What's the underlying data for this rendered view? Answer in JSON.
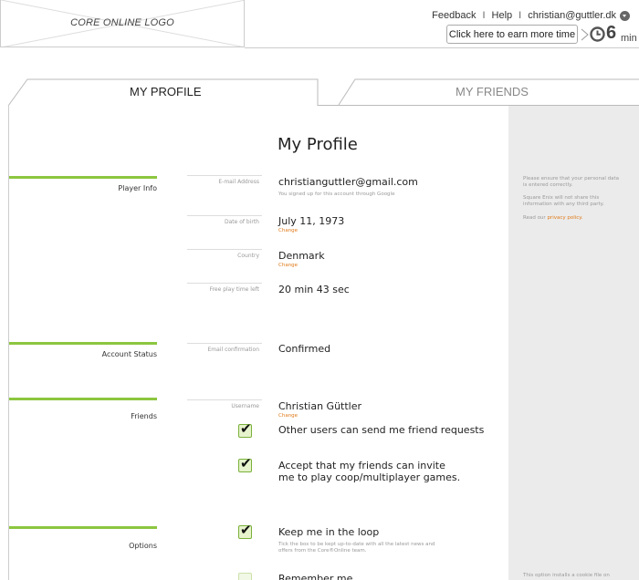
{
  "header": {
    "logo_text": "CORE ONLINE LOGO",
    "links": {
      "feedback": "Feedback",
      "help": "Help",
      "user": "christian@guttler.dk",
      "separator": "I"
    },
    "earn_button": "Click here to earn more time",
    "time_value": "6",
    "time_unit": "min"
  },
  "tabs": [
    {
      "label": "MY PROFILE",
      "active": true
    },
    {
      "label": "MY FRIENDS",
      "active": false
    }
  ],
  "page_title": "My Profile",
  "sections": {
    "player_info": "Player Info",
    "account_status": "Account Status",
    "friends": "Friends",
    "options": "Options"
  },
  "fields": {
    "email": {
      "label": "E-mail Address",
      "value": "christianguttler@gmail.com",
      "note": "You signed up for this account through Google"
    },
    "dob": {
      "label": "Date of birth",
      "value": "July 11, 1973",
      "change": "Change"
    },
    "country": {
      "label": "Country",
      "value": "Denmark",
      "change": "Change"
    },
    "playtime": {
      "label": "Free play time left",
      "value": "20 min 43 sec"
    },
    "email_confirmation": {
      "label": "Email confirmation",
      "value": "Confirmed"
    },
    "username": {
      "label": "Username",
      "value": "Christian Güttler",
      "change": "Change"
    }
  },
  "checkboxes": {
    "friend_requests": {
      "label": "Other users can send me friend requests",
      "checked": true
    },
    "coop_invites": {
      "label": "Accept that my friends can invite me to play coop/multiplayer games.",
      "checked": true
    },
    "loop": {
      "label": "Keep me in the loop",
      "checked": true,
      "note": "Tick the box to be kept up-to-date with all the latest news and offers from the Core®Online team."
    },
    "remember": {
      "label": "Remember me",
      "checked": false
    }
  },
  "sidebar": {
    "note1": "Please ensure that your personal data is entered correctly.",
    "note2": "Square Enix will not share this information with any third party.",
    "note3_prefix": "Read our",
    "note3_link": "privacy policy.",
    "cookie_note": "This option installs a cookie file on"
  },
  "colors": {
    "accent": "#8cc63f",
    "link": "#e07b1a",
    "sidebar_bg": "#ebebeb"
  },
  "icons": {
    "clock": "clock-icon",
    "user_menu": "chevron-down-icon",
    "check": "checkmark-icon"
  }
}
